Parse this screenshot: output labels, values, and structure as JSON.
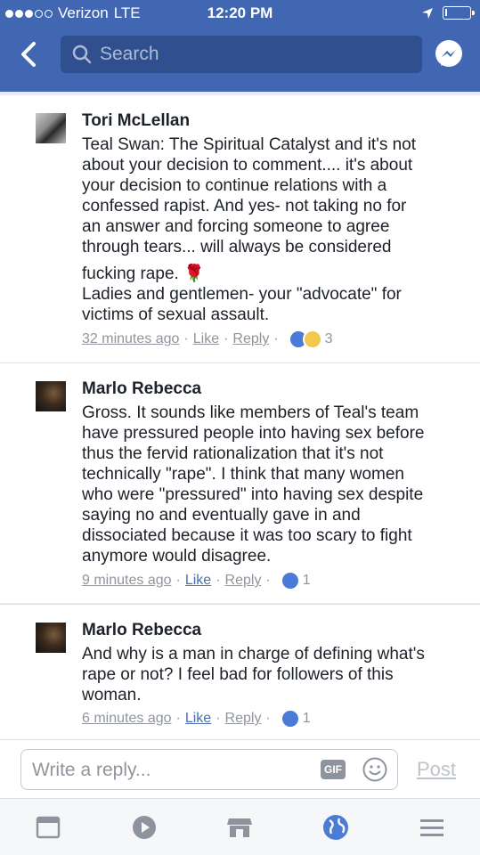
{
  "status_bar": {
    "carrier": "Verizon",
    "network": "LTE",
    "time": "12:20 PM"
  },
  "nav": {
    "search_placeholder": "Search"
  },
  "comments": [
    {
      "author": "Tori McLellan",
      "text_lines": [
        "Teal Swan: The Spiritual Catalyst and it's not",
        "about your decision to comment.... it's about",
        "your decision to continue relations with a",
        "confessed rapist. And yes- not taking no for",
        "an answer and forcing someone to agree",
        "through tears... will always be considered",
        "fucking rape. 🌹",
        "Ladies and gentlemen- your \"advocate\" for",
        "victims of sexual assault."
      ],
      "time": "32 minutes ago",
      "like_label": "Like",
      "reply_label": "Reply",
      "reaction_count": "3"
    },
    {
      "author": "Marlo Rebecca",
      "text_lines": [
        "Gross. It sounds like members of Teal's team",
        "have pressured people into having sex before",
        "thus the fervid rationalization that it's not",
        "technically \"rape\". I think that many women",
        "who were \"pressured\" into having sex despite",
        "saying no and eventually gave in and",
        "dissociated because it was too scary to fight",
        "anymore would disagree."
      ],
      "time": "9 minutes ago",
      "like_label": "Like",
      "reply_label": "Reply",
      "reaction_count": "1"
    },
    {
      "author": "Marlo Rebecca",
      "text_lines": [
        "And why is a man in charge of defining what's",
        "rape or not? I feel bad for followers of this",
        "woman."
      ],
      "time": "6 minutes ago",
      "like_label": "Like",
      "reply_label": "Reply",
      "reaction_count": "1"
    }
  ],
  "reply_bar": {
    "placeholder": "Write a reply...",
    "gif_label": "GIF",
    "post_label": "Post"
  },
  "tabs": [
    {
      "icon": "news-feed-icon"
    },
    {
      "icon": "video-icon"
    },
    {
      "icon": "marketplace-icon"
    },
    {
      "icon": "globe-notifications-icon"
    },
    {
      "icon": "menu-icon"
    }
  ],
  "colors": {
    "brand": "#4267b2",
    "like_blue": "#4a7bd6",
    "link_blue": "#4b6fb0",
    "meta_gray": "#90949c"
  }
}
